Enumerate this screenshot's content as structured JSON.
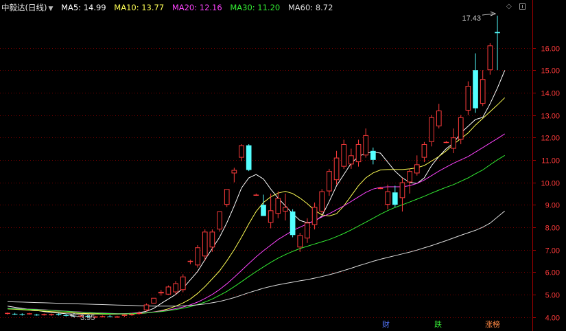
{
  "legend": {
    "stock_name": "中毅达(日线)",
    "ma5": "MA5: 14.99",
    "ma10": "MA10: 13.77",
    "ma20": "MA20: 12.16",
    "ma30": "MA30: 11.20",
    "ma60": "MA60: 8.72"
  },
  "annotations": {
    "high": "17.43",
    "low": "3.95"
  },
  "bottom_tags": {
    "finance": "财",
    "drop": "跌",
    "limit_up": "涨榜"
  },
  "icons": {
    "dropdown": "dropdown-triangle-icon",
    "diamond": "diamond-icon",
    "panel_toggle": "panel-toggle-icon"
  },
  "colors": {
    "background": "#000000",
    "up": "#ff3b3b",
    "down": "#54ffff",
    "ma5": "#ffffff",
    "ma10": "#ffff55",
    "ma20": "#ff44ff",
    "ma30": "#33ee33",
    "ma60": "#dddddd",
    "grid": "#7a0000",
    "axis_text": "#ff3b3b"
  },
  "chart_data": {
    "type": "candlestick",
    "y_axis": {
      "ticks": [
        4.0,
        5.0,
        6.0,
        7.0,
        8.0,
        9.0,
        10.0,
        11.0,
        12.0,
        13.0,
        14.0,
        15.0,
        16.0
      ],
      "ylim": [
        3.9,
        17.6
      ],
      "grid": true,
      "position": "right"
    },
    "candles": [
      {
        "o": 4.15,
        "h": 4.2,
        "l": 4.1,
        "c": 4.18
      },
      {
        "o": 4.14,
        "h": 4.18,
        "l": 4.08,
        "c": 4.12
      },
      {
        "o": 4.12,
        "h": 4.16,
        "l": 4.06,
        "c": 4.1
      },
      {
        "o": 4.12,
        "h": 4.18,
        "l": 4.1,
        "c": 4.16
      },
      {
        "o": 4.1,
        "h": 4.14,
        "l": 4.05,
        "c": 4.08
      },
      {
        "o": 4.09,
        "h": 4.15,
        "l": 4.06,
        "c": 4.12
      },
      {
        "o": 4.1,
        "h": 4.15,
        "l": 4.05,
        "c": 4.12
      },
      {
        "o": 4.12,
        "h": 4.16,
        "l": 4.06,
        "c": 4.08
      },
      {
        "o": 4.08,
        "h": 4.12,
        "l": 4.02,
        "c": 4.05
      },
      {
        "o": 4.05,
        "h": 4.1,
        "l": 4.0,
        "c": 4.03
      },
      {
        "o": 4.03,
        "h": 4.08,
        "l": 3.98,
        "c": 4.06
      },
      {
        "o": 4.05,
        "h": 4.09,
        "l": 3.97,
        "c": 4.0
      },
      {
        "o": 4.0,
        "h": 4.05,
        "l": 3.95,
        "c": 4.02
      },
      {
        "o": 4.0,
        "h": 4.06,
        "l": 3.98,
        "c": 4.03
      },
      {
        "o": 4.02,
        "h": 4.08,
        "l": 3.99,
        "c": 4.01
      },
      {
        "o": 4.0,
        "h": 4.05,
        "l": 3.96,
        "c": 4.02
      },
      {
        "o": 4.05,
        "h": 4.12,
        "l": 4.0,
        "c": 4.1
      },
      {
        "o": 4.1,
        "h": 4.18,
        "l": 4.05,
        "c": 4.12
      },
      {
        "o": 4.15,
        "h": 4.25,
        "l": 4.1,
        "c": 4.18
      },
      {
        "o": 4.3,
        "h": 4.6,
        "l": 4.25,
        "c": 4.55
      },
      {
        "o": 4.6,
        "h": 4.85,
        "l": 4.6,
        "c": 4.85
      },
      {
        "o": 5.05,
        "h": 5.2,
        "l": 4.95,
        "c": 5.12
      },
      {
        "o": 5.0,
        "h": 5.4,
        "l": 4.98,
        "c": 5.35
      },
      {
        "o": 5.1,
        "h": 5.6,
        "l": 5.0,
        "c": 5.5
      },
      {
        "o": 5.2,
        "h": 5.9,
        "l": 5.1,
        "c": 5.8
      },
      {
        "o": 6.45,
        "h": 6.55,
        "l": 6.35,
        "c": 6.5
      },
      {
        "o": 6.3,
        "h": 7.2,
        "l": 6.2,
        "c": 7.1
      },
      {
        "o": 6.7,
        "h": 7.9,
        "l": 6.5,
        "c": 7.8
      },
      {
        "o": 7.1,
        "h": 7.9,
        "l": 6.9,
        "c": 7.8
      },
      {
        "o": 7.9,
        "h": 8.7,
        "l": 7.8,
        "c": 8.7
      },
      {
        "o": 9.0,
        "h": 9.7,
        "l": 8.9,
        "c": 9.7
      },
      {
        "o": 10.4,
        "h": 10.65,
        "l": 10.0,
        "c": 10.55
      },
      {
        "o": 11.1,
        "h": 11.7,
        "l": 10.95,
        "c": 11.65
      },
      {
        "o": 11.65,
        "h": 11.7,
        "l": 10.5,
        "c": 10.55
      },
      {
        "o": 9.45,
        "h": 9.5,
        "l": 9.4,
        "c": 9.45
      },
      {
        "o": 9.0,
        "h": 9.45,
        "l": 8.5,
        "c": 8.5
      },
      {
        "o": 8.2,
        "h": 9.5,
        "l": 7.95,
        "c": 8.75
      },
      {
        "o": 8.6,
        "h": 9.6,
        "l": 8.4,
        "c": 9.3
      },
      {
        "o": 8.7,
        "h": 9.5,
        "l": 8.3,
        "c": 8.9
      },
      {
        "o": 8.7,
        "h": 8.8,
        "l": 7.55,
        "c": 7.65
      },
      {
        "o": 7.1,
        "h": 7.75,
        "l": 6.9,
        "c": 7.65
      },
      {
        "o": 7.5,
        "h": 8.4,
        "l": 7.3,
        "c": 8.2
      },
      {
        "o": 8.1,
        "h": 9.1,
        "l": 7.9,
        "c": 8.9
      },
      {
        "o": 8.7,
        "h": 9.7,
        "l": 8.6,
        "c": 9.6
      },
      {
        "o": 9.6,
        "h": 10.6,
        "l": 9.4,
        "c": 10.5
      },
      {
        "o": 10.1,
        "h": 11.4,
        "l": 9.9,
        "c": 11.1
      },
      {
        "o": 10.7,
        "h": 11.9,
        "l": 10.6,
        "c": 11.7
      },
      {
        "o": 10.8,
        "h": 11.5,
        "l": 10.6,
        "c": 11.2
      },
      {
        "o": 10.9,
        "h": 11.9,
        "l": 10.7,
        "c": 11.7
      },
      {
        "o": 11.2,
        "h": 12.4,
        "l": 11.1,
        "c": 12.1
      },
      {
        "o": 11.4,
        "h": 11.55,
        "l": 10.8,
        "c": 11.0
      },
      {
        "o": 9.75,
        "h": 9.8,
        "l": 9.7,
        "c": 9.75
      },
      {
        "o": 9.0,
        "h": 9.9,
        "l": 8.8,
        "c": 9.6
      },
      {
        "o": 9.55,
        "h": 9.85,
        "l": 8.9,
        "c": 9.0
      },
      {
        "o": 9.3,
        "h": 10.2,
        "l": 8.7,
        "c": 10.0
      },
      {
        "o": 10.0,
        "h": 10.6,
        "l": 9.5,
        "c": 10.5
      },
      {
        "o": 10.4,
        "h": 11.2,
        "l": 10.3,
        "c": 10.8
      },
      {
        "o": 11.1,
        "h": 11.8,
        "l": 10.9,
        "c": 11.7
      },
      {
        "o": 11.8,
        "h": 13.0,
        "l": 11.6,
        "c": 12.9
      },
      {
        "o": 12.5,
        "h": 13.5,
        "l": 12.4,
        "c": 13.2
      },
      {
        "o": 11.8,
        "h": 11.85,
        "l": 11.75,
        "c": 11.8
      },
      {
        "o": 11.5,
        "h": 12.4,
        "l": 11.3,
        "c": 12.0
      },
      {
        "o": 11.9,
        "h": 13.0,
        "l": 11.7,
        "c": 12.9
      },
      {
        "o": 13.2,
        "h": 14.5,
        "l": 13.0,
        "c": 14.3
      },
      {
        "o": 15.0,
        "h": 15.75,
        "l": 13.1,
        "c": 13.3
      },
      {
        "o": 13.5,
        "h": 15.0,
        "l": 13.4,
        "c": 14.6
      },
      {
        "o": 15.0,
        "h": 16.2,
        "l": 14.8,
        "c": 16.1
      },
      {
        "o": 16.7,
        "h": 17.43,
        "l": 15.0,
        "c": 16.65
      }
    ],
    "ma_series": [
      {
        "name": "MA5",
        "values": [
          4.48,
          4.43,
          4.38,
          4.34,
          4.29,
          4.24,
          4.2,
          4.17,
          4.14,
          4.13,
          4.13,
          4.13,
          4.13,
          4.13,
          4.13,
          4.13,
          4.14,
          4.16,
          4.19,
          4.25,
          4.38,
          4.6,
          4.8,
          5.0,
          5.28,
          5.65,
          6.03,
          6.55,
          7.05,
          7.55,
          8.2,
          8.95,
          9.75,
          10.2,
          10.35,
          10.15,
          9.7,
          9.3,
          8.95,
          8.6,
          8.3,
          8.2,
          8.25,
          8.5,
          9.15,
          9.85,
          10.35,
          10.85,
          11.15,
          11.3,
          11.35,
          11.3,
          10.9,
          10.5,
          10.2,
          10.0,
          9.95,
          10.2,
          10.75,
          11.15,
          11.5,
          11.75,
          12.2,
          12.5,
          12.8,
          12.9,
          13.5,
          14.2,
          14.99
        ]
      },
      {
        "name": "MA10",
        "values": [
          4.36,
          4.34,
          4.32,
          4.3,
          4.28,
          4.26,
          4.24,
          4.22,
          4.2,
          4.18,
          4.16,
          4.15,
          4.14,
          4.13,
          4.13,
          4.13,
          4.13,
          4.14,
          4.15,
          4.18,
          4.22,
          4.28,
          4.36,
          4.48,
          4.62,
          4.8,
          5.05,
          5.35,
          5.7,
          6.05,
          6.5,
          7.0,
          7.55,
          8.15,
          8.7,
          9.1,
          9.35,
          9.52,
          9.6,
          9.5,
          9.3,
          9.05,
          8.75,
          8.55,
          8.5,
          8.6,
          8.95,
          9.4,
          9.85,
          10.2,
          10.42,
          10.55,
          10.57,
          10.57,
          10.57,
          10.6,
          10.65,
          10.75,
          10.95,
          11.15,
          11.4,
          11.7,
          11.95,
          12.2,
          12.55,
          12.85,
          13.15,
          13.45,
          13.77
        ]
      },
      {
        "name": "MA20",
        "values": [
          4.38,
          4.37,
          4.36,
          4.35,
          4.34,
          4.32,
          4.3,
          4.28,
          4.26,
          4.24,
          4.22,
          4.2,
          4.18,
          4.17,
          4.16,
          4.15,
          4.15,
          4.16,
          4.17,
          4.19,
          4.22,
          4.26,
          4.31,
          4.37,
          4.44,
          4.54,
          4.66,
          4.82,
          5.0,
          5.22,
          5.48,
          5.77,
          6.07,
          6.38,
          6.68,
          6.95,
          7.2,
          7.45,
          7.65,
          7.85,
          8.0,
          8.15,
          8.3,
          8.45,
          8.6,
          8.78,
          8.95,
          9.15,
          9.35,
          9.55,
          9.7,
          9.78,
          9.8,
          9.8,
          9.8,
          9.85,
          9.95,
          10.1,
          10.3,
          10.5,
          10.68,
          10.85,
          11.0,
          11.15,
          11.35,
          11.55,
          11.75,
          11.95,
          12.16
        ]
      },
      {
        "name": "MA30",
        "values": [
          4.37,
          4.36,
          4.35,
          4.34,
          4.33,
          4.31,
          4.29,
          4.27,
          4.25,
          4.23,
          4.21,
          4.19,
          4.17,
          4.16,
          4.15,
          4.14,
          4.14,
          4.15,
          4.16,
          4.18,
          4.21,
          4.24,
          4.28,
          4.33,
          4.39,
          4.46,
          4.55,
          4.66,
          4.8,
          4.96,
          5.14,
          5.35,
          5.57,
          5.8,
          6.02,
          6.23,
          6.43,
          6.62,
          6.78,
          6.92,
          7.05,
          7.15,
          7.25,
          7.35,
          7.45,
          7.58,
          7.72,
          7.88,
          8.05,
          8.22,
          8.4,
          8.58,
          8.74,
          8.88,
          9.0,
          9.12,
          9.25,
          9.38,
          9.52,
          9.65,
          9.78,
          9.9,
          10.05,
          10.2,
          10.38,
          10.55,
          10.78,
          11.0,
          11.2
        ]
      },
      {
        "name": "MA60",
        "values": [
          4.68,
          4.67,
          4.66,
          4.65,
          4.64,
          4.63,
          4.62,
          4.61,
          4.6,
          4.59,
          4.58,
          4.57,
          4.56,
          4.55,
          4.54,
          4.53,
          4.52,
          4.51,
          4.5,
          4.49,
          4.48,
          4.48,
          4.48,
          4.48,
          4.49,
          4.51,
          4.54,
          4.58,
          4.63,
          4.69,
          4.77,
          4.86,
          4.97,
          5.08,
          5.18,
          5.28,
          5.36,
          5.43,
          5.49,
          5.55,
          5.61,
          5.66,
          5.73,
          5.8,
          5.88,
          5.97,
          6.07,
          6.17,
          6.28,
          6.38,
          6.48,
          6.57,
          6.65,
          6.73,
          6.81,
          6.89,
          6.98,
          7.08,
          7.18,
          7.29,
          7.4,
          7.52,
          7.64,
          7.75,
          7.86,
          8.0,
          8.18,
          8.45,
          8.72
        ]
      }
    ]
  }
}
